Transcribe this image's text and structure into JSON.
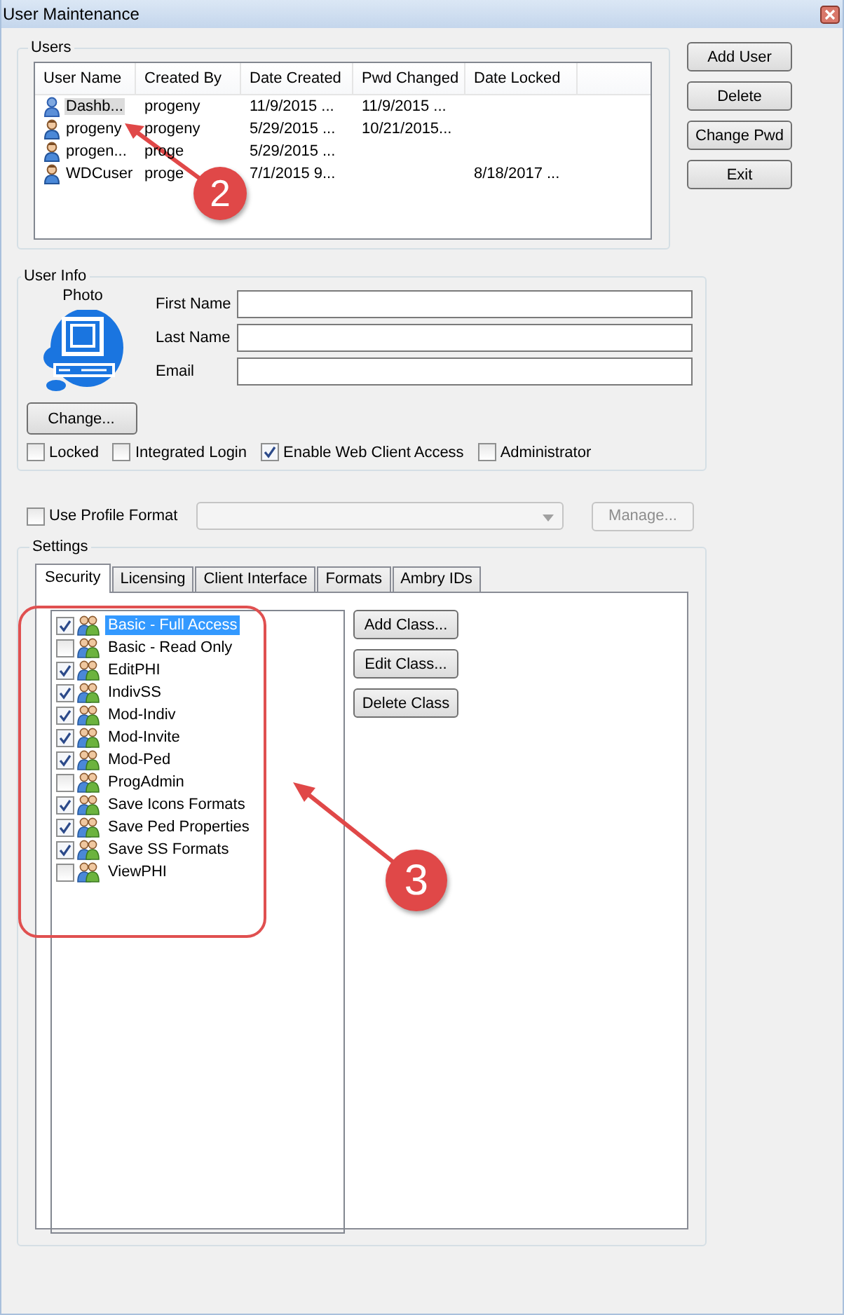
{
  "window": {
    "title": "User Maintenance"
  },
  "users": {
    "title": "Users",
    "columns": [
      "User Name",
      "Created By",
      "Date Created",
      "Pwd Changed",
      "Date Locked"
    ],
    "rows": [
      {
        "kind": "service",
        "selected": true,
        "cells": [
          "Dashb...",
          "progeny",
          "11/9/2015 ...",
          "11/9/2015 ...",
          ""
        ]
      },
      {
        "kind": "user",
        "selected": false,
        "cells": [
          "progeny",
          "progeny",
          "5/29/2015 ...",
          "10/21/2015...",
          ""
        ]
      },
      {
        "kind": "user",
        "selected": false,
        "cells": [
          "progen...",
          "proge",
          "5/29/2015 ...",
          "",
          ""
        ]
      },
      {
        "kind": "user",
        "selected": false,
        "cells": [
          "WDCuser",
          "proge",
          "7/1/2015 9...",
          "",
          "8/18/2017 ..."
        ]
      }
    ]
  },
  "side_buttons": [
    "Add User",
    "Delete",
    "Change Pwd",
    "Exit"
  ],
  "user_info": {
    "title": "User Info",
    "photo_label": "Photo",
    "change_button": "Change...",
    "fields": [
      {
        "label": "First Name"
      },
      {
        "label": "Last Name"
      },
      {
        "label": "Email"
      }
    ],
    "checkboxes": [
      {
        "label": "Locked",
        "checked": false
      },
      {
        "label": "Integrated Login",
        "checked": false
      },
      {
        "label": "Enable Web Client Access",
        "checked": true
      },
      {
        "label": "Administrator",
        "checked": false
      }
    ]
  },
  "profile": {
    "label": "Use Profile Format",
    "checked": false,
    "combo_disabled": true,
    "manage_button": "Manage...",
    "manage_disabled": true
  },
  "settings": {
    "title": "Settings",
    "tabs": [
      {
        "label": "Security",
        "selected": true
      },
      {
        "label": "Licensing",
        "selected": false
      },
      {
        "label": "Client Interface",
        "selected": false
      },
      {
        "label": "Formats",
        "selected": false
      },
      {
        "label": "Ambry IDs",
        "selected": false
      }
    ],
    "classes": [
      {
        "label": "Basic - Full Access",
        "checked": true,
        "selected": true
      },
      {
        "label": "Basic - Read Only",
        "checked": false,
        "selected": false
      },
      {
        "label": "EditPHI",
        "checked": true,
        "selected": false
      },
      {
        "label": "IndivSS",
        "checked": true,
        "selected": false
      },
      {
        "label": "Mod-Indiv",
        "checked": true,
        "selected": false
      },
      {
        "label": "Mod-Invite",
        "checked": true,
        "selected": false
      },
      {
        "label": "Mod-Ped",
        "checked": true,
        "selected": false
      },
      {
        "label": "ProgAdmin",
        "checked": false,
        "selected": false
      },
      {
        "label": "Save Icons Formats",
        "checked": true,
        "selected": false
      },
      {
        "label": "Save Ped Properties",
        "checked": true,
        "selected": false
      },
      {
        "label": "Save SS Formats",
        "checked": true,
        "selected": false
      },
      {
        "label": "ViewPHI",
        "checked": false,
        "selected": false
      }
    ],
    "buttons": [
      "Add Class...",
      "Edit Class...",
      "Delete Class"
    ]
  },
  "annotations": [
    {
      "number": "2"
    },
    {
      "number": "3"
    }
  ]
}
